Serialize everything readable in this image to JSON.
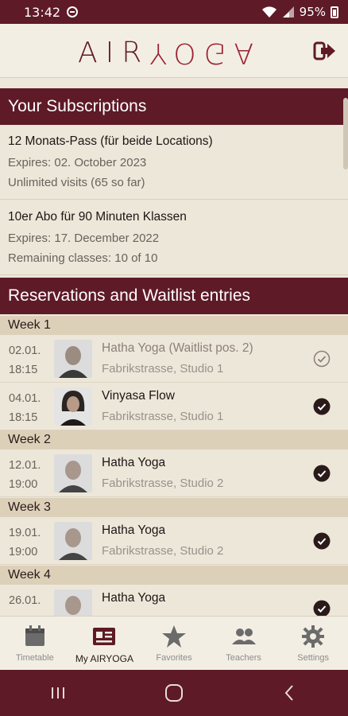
{
  "status_bar": {
    "time": "13:42",
    "battery": "95%"
  },
  "app": {
    "logo_air": "AIR",
    "logo_yoga": "YOGA"
  },
  "subscriptions": {
    "header": "Your Subscriptions",
    "items": [
      {
        "name": "12 Monats-Pass (für beide Locations)",
        "line1": "Expires: 02. October 2023",
        "line2": "Unlimited visits (65 so far)"
      },
      {
        "name": "10er Abo für 90 Minuten Klassen",
        "line1": "Expires: 17. December 2022",
        "line2": "Remaining classes: 10 of 10"
      }
    ]
  },
  "reservations": {
    "header": "Reservations and Waitlist entries",
    "weeks": [
      {
        "label": "Week 1"
      },
      {
        "label": "Week 2"
      },
      {
        "label": "Week 3"
      },
      {
        "label": "Week 4"
      }
    ],
    "entries": [
      {
        "date": "02.01.",
        "time": "18:15",
        "title": "Hatha Yoga (Waitlist pos. 2)",
        "place": "Fabrikstrasse, Studio 1",
        "status": "waitlist"
      },
      {
        "date": "04.01.",
        "time": "18:15",
        "title": "Vinyasa Flow",
        "place": "Fabrikstrasse, Studio 1",
        "status": "confirmed"
      },
      {
        "date": "12.01.",
        "time": "19:00",
        "title": "Hatha Yoga",
        "place": "Fabrikstrasse, Studio 2",
        "status": "confirmed"
      },
      {
        "date": "19.01.",
        "time": "19:00",
        "title": "Hatha Yoga",
        "place": "Fabrikstrasse, Studio 2",
        "status": "confirmed"
      },
      {
        "date": "26.01.",
        "time": "",
        "title": "Hatha Yoga",
        "place": "",
        "status": "confirmed"
      }
    ]
  },
  "tabs": [
    {
      "label": "Timetable",
      "icon": "calendar-icon"
    },
    {
      "label": "My AIRYOGA",
      "icon": "id-card-icon",
      "active": true
    },
    {
      "label": "Favorites",
      "icon": "star-icon"
    },
    {
      "label": "Teachers",
      "icon": "people-icon"
    },
    {
      "label": "Settings",
      "icon": "gear-icon"
    }
  ],
  "colors": {
    "primary": "#5e1a27",
    "accent": "#9c2231",
    "background": "#ede7da",
    "week_band": "#ddd0b9"
  }
}
